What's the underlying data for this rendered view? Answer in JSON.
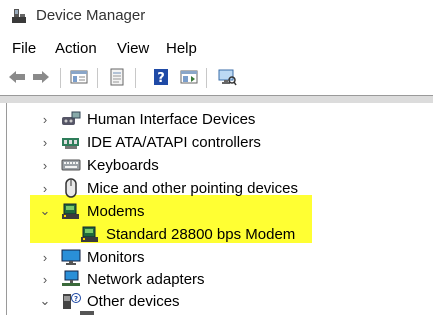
{
  "window": {
    "title": "Device Manager"
  },
  "menu": [
    "File",
    "Action",
    "View",
    "Help"
  ],
  "toolbar": {
    "buttons": [
      "back-icon",
      "forward-icon",
      "show-hide-console-tree-icon",
      "properties-icon",
      "help-icon",
      "run-action-icon",
      "scan-hardware-icon"
    ]
  },
  "tree": {
    "items": [
      {
        "label": "Human Interface Devices",
        "icon": "hid-icon",
        "expanded": false
      },
      {
        "label": "IDE ATA/ATAPI controllers",
        "icon": "ide-controller-icon",
        "expanded": false
      },
      {
        "label": "Keyboards",
        "icon": "keyboard-icon",
        "expanded": false
      },
      {
        "label": "Mice and other pointing devices",
        "icon": "mouse-icon",
        "expanded": false
      },
      {
        "label": "Modems",
        "icon": "modem-icon",
        "expanded": true
      },
      {
        "label": "Standard 28800 bps Modem",
        "icon": "modem-icon",
        "child": true
      },
      {
        "label": "Monitors",
        "icon": "monitor-icon",
        "expanded": false
      },
      {
        "label": "Network adapters",
        "icon": "network-adapter-icon",
        "expanded": false
      },
      {
        "label": "Other devices",
        "icon": "unknown-device-icon",
        "expanded": true
      }
    ]
  },
  "colors": {
    "highlight": "#ffff33",
    "accent": "#0067c0"
  }
}
